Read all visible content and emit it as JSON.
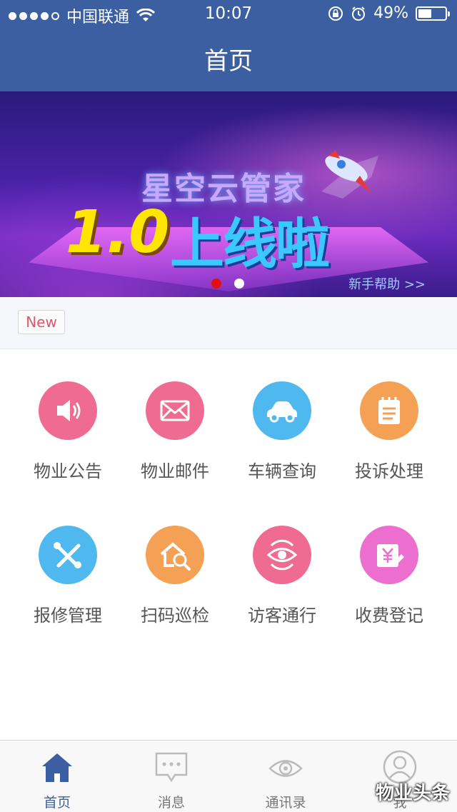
{
  "status_bar": {
    "carrier": "中国联通",
    "time": "10:07",
    "battery": "49%",
    "battery_level": 0.49
  },
  "header": {
    "title": "首页"
  },
  "banner": {
    "headline": "星空云管家",
    "version": "1.0",
    "tagline": "上线啦",
    "help_link": "新手帮助 >>",
    "page_count": 2,
    "active_page": 1
  },
  "new_badge": "New",
  "grid": [
    {
      "label": "物业公告",
      "icon": "speaker-icon",
      "color": "#f06b92"
    },
    {
      "label": "物业邮件",
      "icon": "mail-icon",
      "color": "#f06b92"
    },
    {
      "label": "车辆查询",
      "icon": "car-icon",
      "color": "#4fb8ee"
    },
    {
      "label": "投诉处理",
      "icon": "notepad-icon",
      "color": "#f5a155"
    },
    {
      "label": "报修管理",
      "icon": "tools-icon",
      "color": "#4fb8ee"
    },
    {
      "label": "扫码巡检",
      "icon": "house-scan-icon",
      "color": "#f5a155"
    },
    {
      "label": "访客通行",
      "icon": "eye-icon",
      "color": "#f06b92"
    },
    {
      "label": "收费登记",
      "icon": "fee-icon",
      "color": "#ec6fcf"
    }
  ],
  "tabbar": [
    {
      "label": "首页",
      "icon": "home-icon",
      "active": true
    },
    {
      "label": "消息",
      "icon": "message-icon",
      "active": false
    },
    {
      "label": "通讯录",
      "icon": "contacts-eye-icon",
      "active": false
    },
    {
      "label": "我",
      "icon": "user-icon",
      "active": false
    }
  ],
  "colors": {
    "nav": "#3b5fa0",
    "active_tab": "#3b5fa0",
    "badge_text": "#e0566a"
  },
  "watermark": "物业头条"
}
